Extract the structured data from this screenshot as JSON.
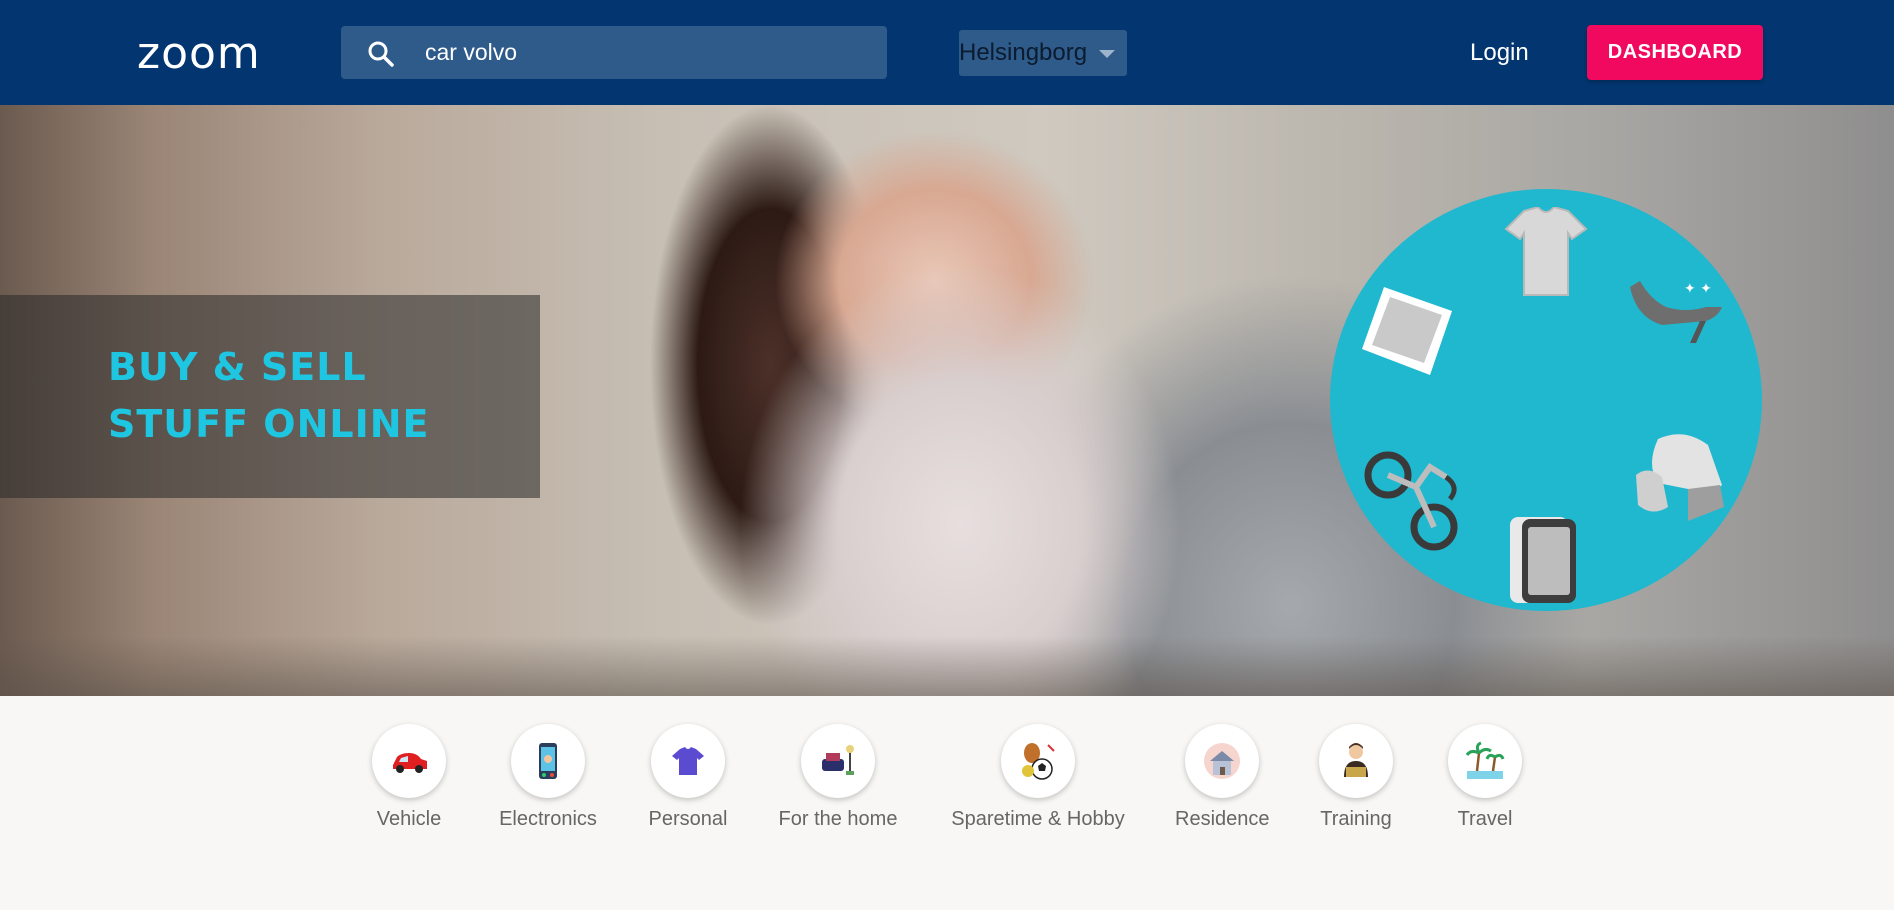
{
  "header": {
    "logo": "zoom",
    "search_value": "car volvo",
    "city": "Helsingborg",
    "login_label": "Login",
    "dashboard_label": "DASHBOARD"
  },
  "hero": {
    "tagline_line1": "BUY & SELL",
    "tagline_line2": "STUFF ONLINE"
  },
  "categories": [
    {
      "label": "Vehicle",
      "icon": "car-icon"
    },
    {
      "label": "Electronics",
      "icon": "phone-icon"
    },
    {
      "label": "Personal",
      "icon": "tshirt-icon"
    },
    {
      "label": "For the home",
      "icon": "home-furniture-icon"
    },
    {
      "label": "Sparetime & Hobby",
      "icon": "sports-ball-icon"
    },
    {
      "label": "Residence",
      "icon": "house-icon"
    },
    {
      "label": "Training",
      "icon": "teacher-icon"
    },
    {
      "label": "Travel",
      "icon": "palm-tree-icon"
    }
  ],
  "colors": {
    "header_bg": "#033670",
    "accent": "#f0095f",
    "tagline": "#1ec6e2",
    "circle": "#1fb8cf"
  }
}
